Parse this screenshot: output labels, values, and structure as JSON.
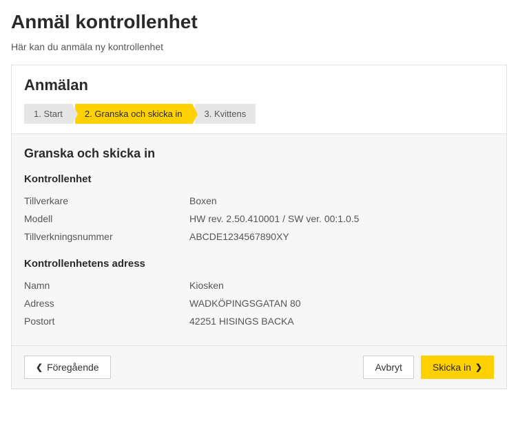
{
  "page": {
    "title": "Anmäl kontrollenhet",
    "subtitle": "Här kan du anmäla ny kontrollenhet"
  },
  "panel": {
    "heading": "Anmälan",
    "steps": [
      {
        "label": "1. Start",
        "active": false
      },
      {
        "label": "2. Granska och skicka in",
        "active": true
      },
      {
        "label": "3. Kvittens",
        "active": false
      }
    ],
    "body_heading": "Granska och skicka in",
    "sections": {
      "device": {
        "heading": "Kontrollenhet",
        "manufacturer_label": "Tillverkare",
        "manufacturer_value": "Boxen",
        "model_label": "Modell",
        "model_value": "HW rev. 2.50.410001 / SW ver. 00:1.0.5",
        "serial_label": "Tillverkningsnummer",
        "serial_value": "ABCDE1234567890XY"
      },
      "address": {
        "heading": "Kontrollenhetens adress",
        "name_label": "Namn",
        "name_value": "Kiosken",
        "address_label": "Adress",
        "address_value": "WADKÖPINGSGATAN 80",
        "postal_label": "Postort",
        "postal_value": "42251 HISINGS BACKA"
      }
    }
  },
  "buttons": {
    "previous": "Föregående",
    "cancel": "Avbryt",
    "submit": "Skicka in"
  }
}
